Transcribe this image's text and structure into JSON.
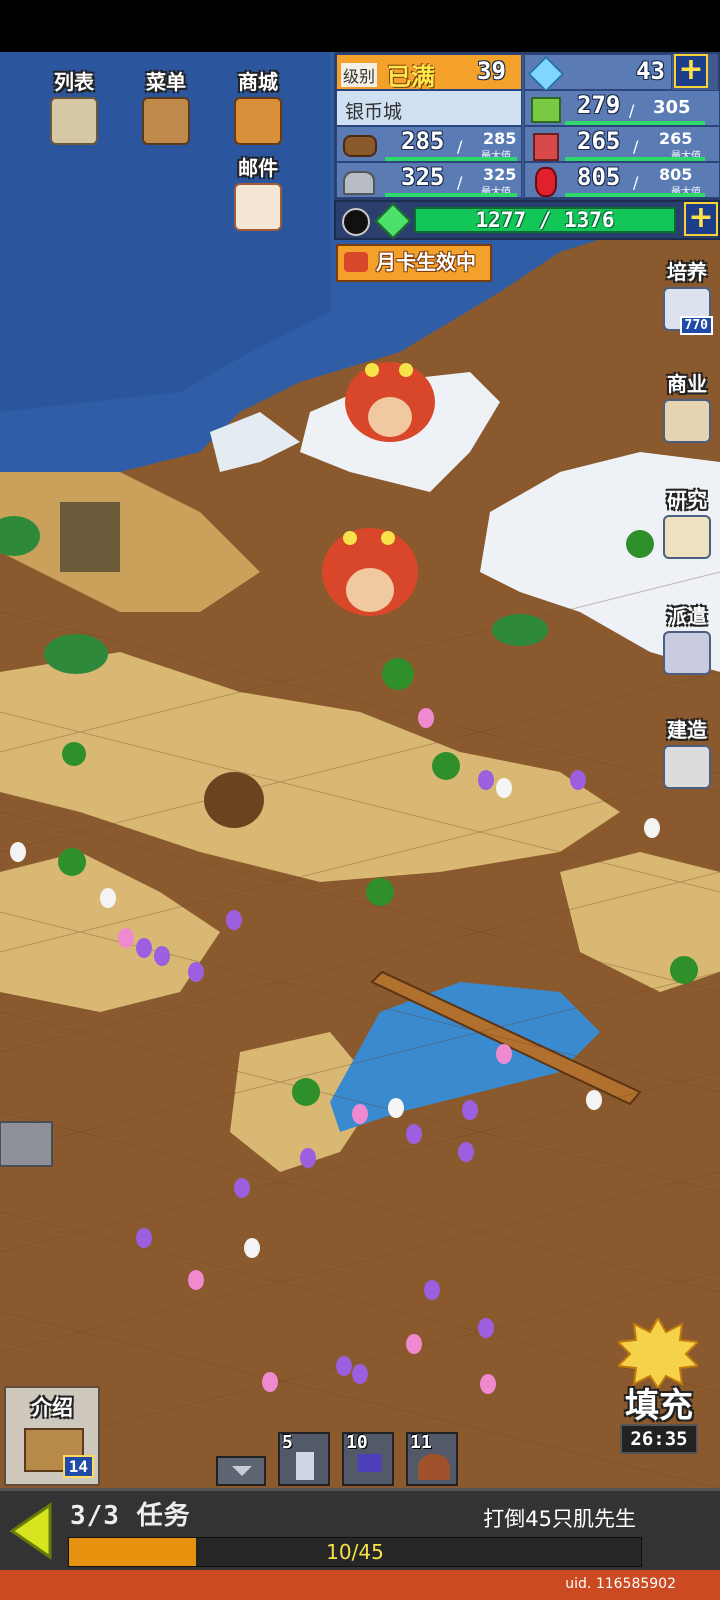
{
  "top_menu": {
    "list": "列表",
    "menu": "菜单",
    "shop": "商城",
    "mail": "邮件"
  },
  "resources": {
    "level_label": "级别",
    "level_badge": "已满",
    "level": "39",
    "diamonds": "43",
    "town_name": "银币城",
    "gold": "279",
    "gold_max": "305",
    "wood": "285",
    "wood_max": "285",
    "food": "265",
    "food_max": "265",
    "ore": "325",
    "ore_max": "325",
    "gems": "805",
    "gems_max": "805",
    "max_label": "最大值",
    "energy": "1277 / 1376"
  },
  "month_card": "月卡生效中",
  "side_menu": {
    "train": "培养",
    "train_count": "770",
    "business": "商业",
    "research": "研究",
    "dispatch": "派遣",
    "build": "建造"
  },
  "bottom": {
    "intro": "介绍",
    "intro_count": "14",
    "slots": [
      "5",
      "10",
      "11"
    ],
    "fill_label": "填充",
    "fill_timer": "26:35"
  },
  "mission": {
    "title": "3/3 任务",
    "goal": "打倒45只肌先生",
    "progress_text": "10/45",
    "progress": 0.222
  },
  "uid": "uid. 116585902",
  "colors": {
    "sea": "#2f5da6",
    "sand": "#d8b872",
    "dirt": "#8a5a2e",
    "snow": "#eef2f6",
    "panel": "#3f5a8f",
    "energy": "#12c657",
    "accent": "#f3a12a"
  }
}
